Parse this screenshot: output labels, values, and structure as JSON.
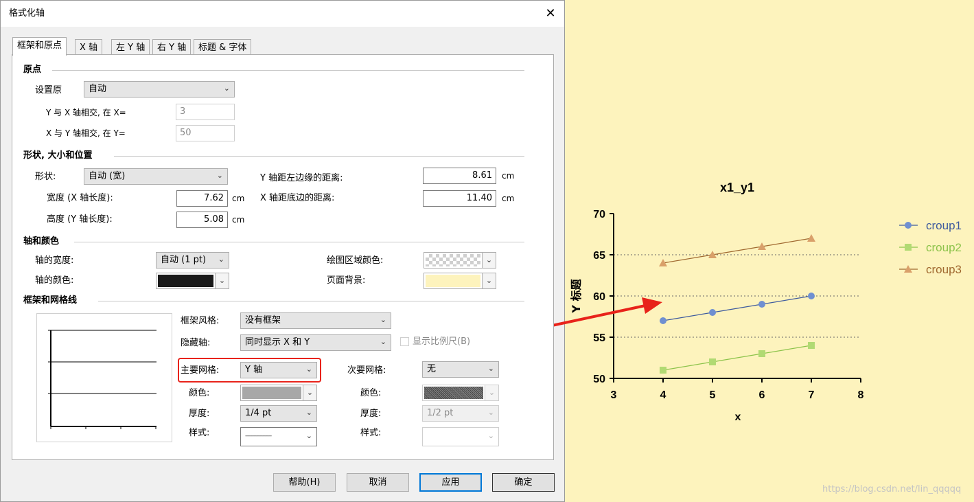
{
  "dialog": {
    "title": "格式化轴",
    "tabs": [
      "框架和原点",
      "X 轴",
      "左 Y 轴",
      "右 Y 轴",
      "标题 & 字体"
    ],
    "origin": {
      "section": "原点",
      "set_origin_label": "设置原",
      "set_origin_value": "自动",
      "y_cross_label": "Y 与 X 轴相交, 在 X=",
      "y_cross_value": "3",
      "x_cross_label": "X 与 Y 轴相交, 在 Y=",
      "x_cross_value": "50"
    },
    "shape": {
      "section": "形状, 大小和位置",
      "shape_label": "形状:",
      "shape_value": "自动 (宽)",
      "width_label": "宽度 (X 轴长度):",
      "width_value": "7.62",
      "height_label": "高度 (Y 轴长度):",
      "height_value": "5.08",
      "y_left_label": "Y 轴距左边缘的距离:",
      "y_left_value": "8.61",
      "x_bottom_label": "X 轴距底边的距离:",
      "x_bottom_value": "11.40",
      "unit": "cm"
    },
    "axis_color": {
      "section": "轴和颜色",
      "thickness_label": "轴的宽度:",
      "thickness_value": "自动 (1 pt)",
      "color_label": "轴的颜色:",
      "axis_color_hex": "#1a1a1a",
      "plot_area_label": "绘图区域颜色:",
      "page_bg_label": "页面背景:",
      "page_bg_hex": "#fdf3bd"
    },
    "frame": {
      "section": "框架和网格线",
      "frame_style_label": "框架风格:",
      "frame_style_value": "没有框架",
      "hide_axes_label": "隐藏轴:",
      "hide_axes_value": "同时显示 X 和 Y",
      "show_scale_label": "显示比例尺(B)",
      "major_grid_label": "主要网格:",
      "major_grid_value": "Y 轴",
      "minor_grid_label": "次要网格:",
      "minor_grid_value": "无",
      "color_label": "颜色:",
      "thickness_label": "厚度:",
      "style_label": "样式:",
      "major_thickness": "1/4 pt",
      "minor_thickness": "1/2 pt",
      "major_style": "-----------------",
      "highlight_color": "#e8231a"
    },
    "buttons": {
      "help": "帮助(H)",
      "cancel": "取消",
      "apply": "应用",
      "ok": "确定"
    }
  },
  "chart_data": {
    "type": "line",
    "title": "x1_y1",
    "xlabel": "x",
    "ylabel": "Y 标题",
    "xlim": [
      3,
      8
    ],
    "ylim": [
      50,
      70
    ],
    "x_ticks": [
      "3",
      "4",
      "5",
      "6",
      "7",
      "8"
    ],
    "y_ticks": [
      "50",
      "55",
      "60",
      "65",
      "70"
    ],
    "grid": "horizontal dotted at 55, 60, 65",
    "legend_position": "right",
    "background": "#fdf3bd",
    "series": [
      {
        "name": "croup1",
        "color": "#6f8fd1",
        "line_color": "#3e5a9e",
        "marker": "circle",
        "x": [
          4,
          5,
          6,
          7
        ],
        "y": [
          57,
          58,
          59,
          60
        ]
      },
      {
        "name": "croup2",
        "color": "#b1da73",
        "line_color": "#8cc34a",
        "marker": "square",
        "x": [
          4,
          5,
          6,
          7
        ],
        "y": [
          51,
          52,
          53,
          54
        ]
      },
      {
        "name": "croup3",
        "color": "#d9a06a",
        "line_color": "#a0682f",
        "marker": "triangle",
        "x": [
          4,
          5,
          6,
          7
        ],
        "y": [
          64,
          65,
          66,
          67
        ]
      }
    ]
  },
  "watermark": "https://blog.csdn.net/lin_qqqqq"
}
